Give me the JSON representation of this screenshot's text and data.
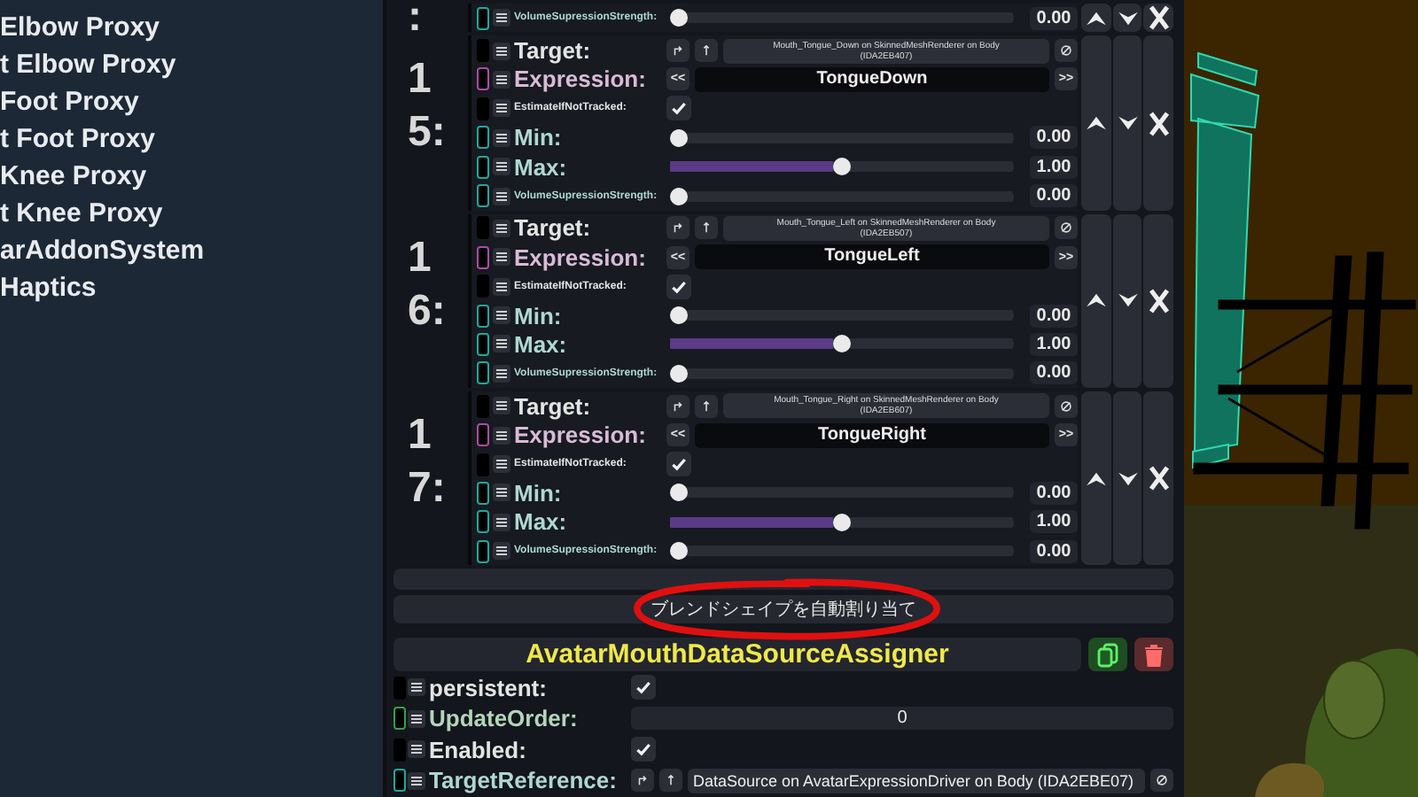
{
  "hierarchy": {
    "items": [
      {
        "label": "Elbow Proxy"
      },
      {
        "label": "t Elbow Proxy"
      },
      {
        "label": "Foot Proxy"
      },
      {
        "label": "t Foot Proxy"
      },
      {
        "label": "Knee Proxy"
      },
      {
        "label": "t Knee Proxy"
      },
      {
        "label": "arAddonSystem"
      },
      {
        "label": "Haptics"
      }
    ]
  },
  "entries": [
    {
      "index": ":",
      "fields": [
        {
          "kind": "slider",
          "label": "VolumeSupressionStrength:",
          "color": "#1fa89a",
          "level": 0,
          "reading": "0.00"
        }
      ]
    },
    {
      "index": "15:",
      "fields": [
        {
          "kind": "reference",
          "label": "Target:",
          "color": "#000000",
          "value": "Mouth_Tongue_Down on SkinnedMeshRenderer on Body (IDA2EB407)"
        },
        {
          "kind": "enum",
          "label": "Expression:",
          "color": "#b04aa6",
          "value": "TongueDown",
          "prev": "<<",
          "next": ">>"
        },
        {
          "kind": "checkbox",
          "label": "EstimateIfNotTracked:",
          "color": "#000000",
          "checked": true
        },
        {
          "kind": "slider",
          "label": "Min:",
          "color": "#1fa89a",
          "level": 0,
          "reading": "0.00"
        },
        {
          "kind": "slider",
          "label": "Max:",
          "color": "#1fa89a",
          "level": 0.5,
          "reading": "1.00"
        },
        {
          "kind": "slider",
          "label": "VolumeSupressionStrength:",
          "color": "#1fa89a",
          "level": 0,
          "reading": "0.00"
        }
      ]
    },
    {
      "index": "16:",
      "fields": [
        {
          "kind": "reference",
          "label": "Target:",
          "color": "#000000",
          "value": "Mouth_Tongue_Left on SkinnedMeshRenderer on Body (IDA2EB507)"
        },
        {
          "kind": "enum",
          "label": "Expression:",
          "color": "#b04aa6",
          "value": "TongueLeft",
          "prev": "<<",
          "next": ">>"
        },
        {
          "kind": "checkbox",
          "label": "EstimateIfNotTracked:",
          "color": "#000000",
          "checked": true
        },
        {
          "kind": "slider",
          "label": "Min:",
          "color": "#1fa89a",
          "level": 0,
          "reading": "0.00"
        },
        {
          "kind": "slider",
          "label": "Max:",
          "color": "#1fa89a",
          "level": 0.5,
          "reading": "1.00"
        },
        {
          "kind": "slider",
          "label": "VolumeSupressionStrength:",
          "color": "#1fa89a",
          "level": 0,
          "reading": "0.00"
        }
      ]
    },
    {
      "index": "17:",
      "fields": [
        {
          "kind": "reference",
          "label": "Target:",
          "color": "#000000",
          "value": "Mouth_Tongue_Right on SkinnedMeshRenderer on Body (IDA2EB607)"
        },
        {
          "kind": "enum",
          "label": "Expression:",
          "color": "#b04aa6",
          "value": "TongueRight",
          "prev": "<<",
          "next": ">>"
        },
        {
          "kind": "checkbox",
          "label": "EstimateIfNotTracked:",
          "color": "#000000",
          "checked": true
        },
        {
          "kind": "slider",
          "label": "Min:",
          "color": "#1fa89a",
          "level": 0,
          "reading": "0.00"
        },
        {
          "kind": "slider",
          "label": "Max:",
          "color": "#1fa89a",
          "level": 0.5,
          "reading": "1.00"
        },
        {
          "kind": "slider",
          "label": "VolumeSupressionStrength:",
          "color": "#1fa89a",
          "level": 0,
          "reading": "0.00"
        }
      ]
    }
  ],
  "auto_assign_button": {
    "label": "ブレンドシェイプを自動割り当て",
    "highlighted": true
  },
  "component": {
    "title": "AvatarMouthDataSourceAssigner",
    "fields": [
      {
        "kind": "checkbox",
        "label": "persistent:",
        "color": "#000000",
        "checked": true
      },
      {
        "kind": "number",
        "label": "UpdateOrder:",
        "color": "#2fa24a",
        "value": "0"
      },
      {
        "kind": "checkbox",
        "label": "Enabled:",
        "color": "#000000",
        "checked": true
      },
      {
        "kind": "reference",
        "label": "TargetReference:",
        "color": "#1fa89a",
        "value": "DataSource on AvatarExpressionDriver on Body (IDA2EBE07)"
      }
    ]
  }
}
